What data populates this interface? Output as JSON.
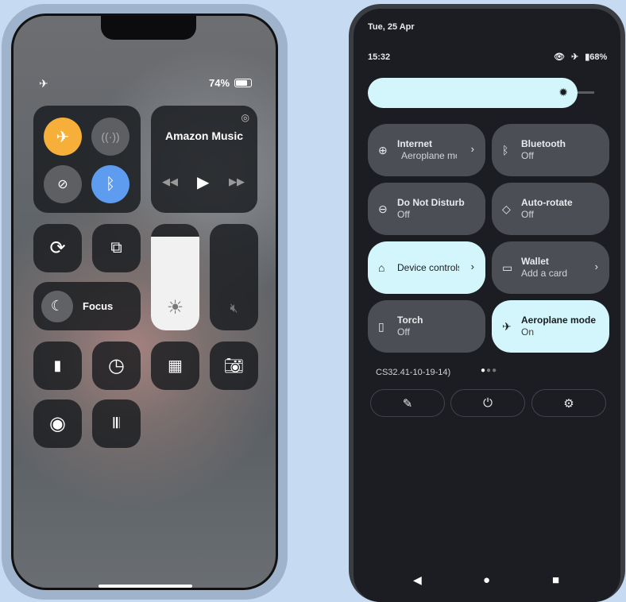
{
  "iphone": {
    "status": {
      "battery": "74%",
      "airplane_icon": "airplane-icon"
    },
    "connectivity": {
      "airplane_color": "#f6b03a",
      "bluetooth_color": "#5e9cf0"
    },
    "music": {
      "title": "Amazon Music"
    },
    "focus": {
      "label": "Focus"
    },
    "brightness_level": 0.88
  },
  "android": {
    "date": "Tue, 25 Apr",
    "time": "15:32",
    "battery": "68%",
    "brightness_level": 0.9,
    "tiles": [
      {
        "title": "Internet",
        "subtitle": "Aeroplane mode",
        "icon": "globe-off-icon",
        "chevron": true,
        "on": false
      },
      {
        "title": "Bluetooth",
        "subtitle": "Off",
        "icon": "bluetooth-icon",
        "on": false
      },
      {
        "title": "Do Not Disturb",
        "subtitle": "Off",
        "icon": "dnd-icon",
        "on": false
      },
      {
        "title": "Auto-rotate",
        "subtitle": "Off",
        "icon": "rotate-icon",
        "on": false
      },
      {
        "title": "Device controls",
        "subtitle": "",
        "icon": "home-icon",
        "chevron": true,
        "on": true
      },
      {
        "title": "Wallet",
        "subtitle": "Add a card",
        "icon": "wallet-icon",
        "chevron": true,
        "on": false
      },
      {
        "title": "Torch",
        "subtitle": "Off",
        "icon": "torch-icon",
        "on": false
      },
      {
        "title": "Aeroplane mode",
        "subtitle": "On",
        "icon": "airplane-icon",
        "on": true
      }
    ],
    "build": "CS32.41-10-19-14)",
    "accent": "#d3f6fd"
  }
}
